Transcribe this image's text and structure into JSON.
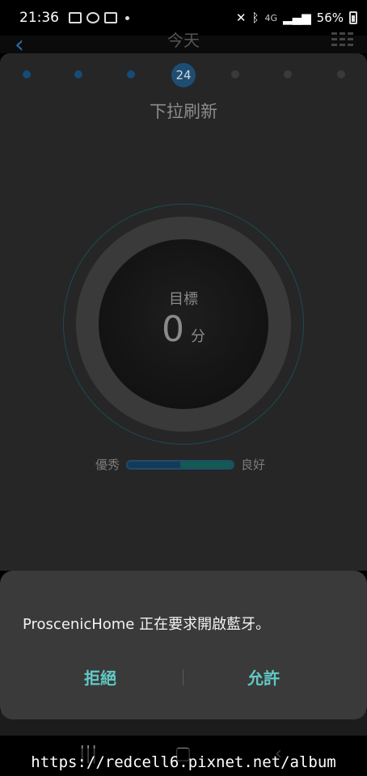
{
  "status_bar": {
    "time": "21:36",
    "network": "4G",
    "battery": "56%"
  },
  "app": {
    "title": "今天",
    "day_selector": {
      "current_day": "24"
    },
    "pull_hint": "下拉刷新",
    "score": {
      "label": "目標",
      "value": "0",
      "unit": "分"
    },
    "legend": {
      "left": "優秀",
      "right": "良好"
    }
  },
  "dialog": {
    "message": "ProscenicHome 正在要求開啟藍牙。",
    "deny_label": "拒絕",
    "allow_label": "允許"
  },
  "watermark": "https://redcell6.pixnet.net/album",
  "colors": {
    "accent": "#61c9c5",
    "dialog_bg": "#3a3a3a",
    "dim_bg": "#262626",
    "blue_dot": "#154b78"
  }
}
